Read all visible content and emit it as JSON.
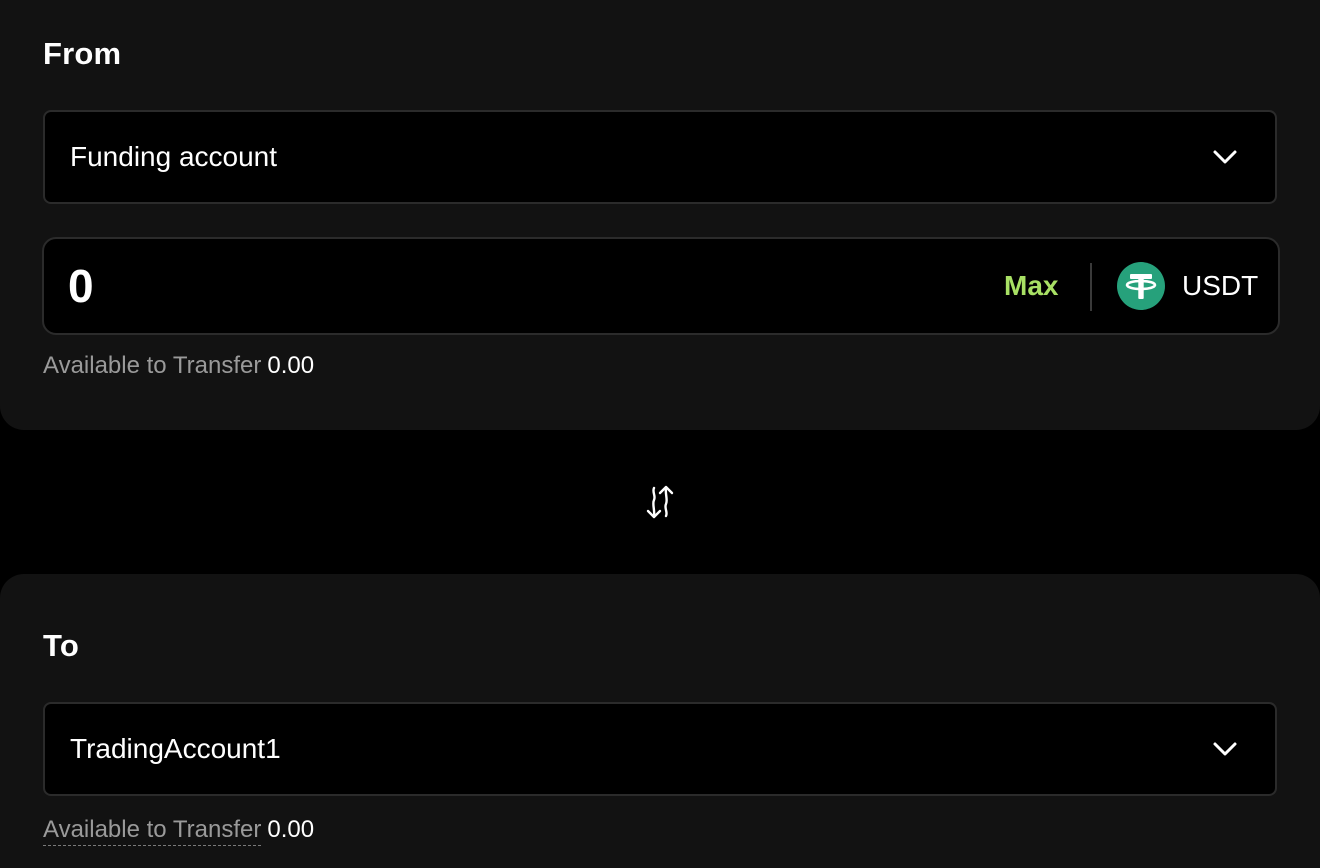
{
  "from": {
    "title": "From",
    "account": "Funding account",
    "amount_value": "0",
    "max_label": "Max",
    "coin": {
      "symbol": "USDT",
      "icon": "tether-icon",
      "color": "#26a17b"
    },
    "available_label": "Available to Transfer",
    "available_value": "0.00"
  },
  "swap": {
    "icon": "swap-arrows-icon"
  },
  "to": {
    "title": "To",
    "account": "TradingAccount1",
    "available_label": "Available to Transfer",
    "available_value": "0.00"
  },
  "theme": {
    "accent": "#a8e064",
    "panel": "#121212",
    "background": "#000000"
  }
}
